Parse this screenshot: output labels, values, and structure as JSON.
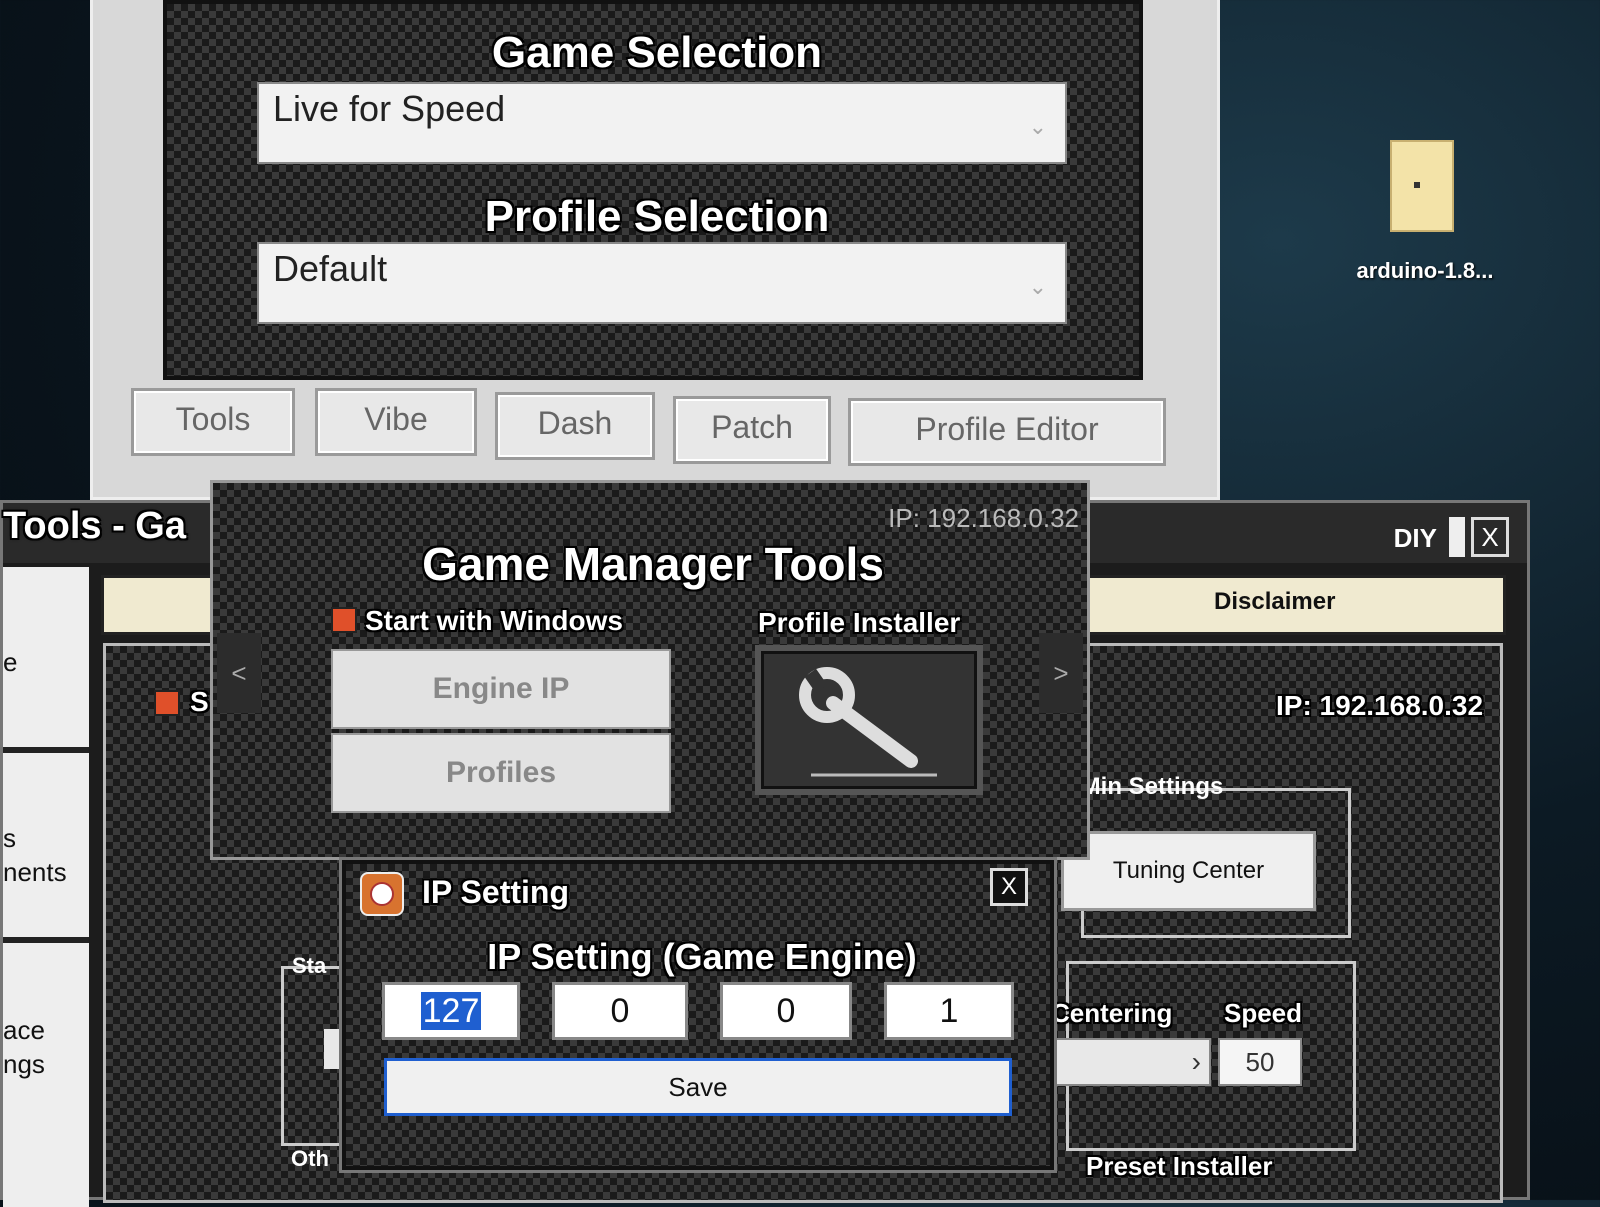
{
  "top_window": {
    "game_heading": "Game Selection",
    "game_value": "Live for Speed",
    "profile_heading": "Profile Selection",
    "profile_value": "Default",
    "tabs": [
      "Tools",
      "Vibe",
      "Dash",
      "Patch",
      "Profile Editor"
    ]
  },
  "back_window": {
    "title_fragment": "Tools - Ga",
    "diy_label": "DIY",
    "close_label": "X",
    "disclaimer_tab": "Disclaimer",
    "ip_label": "IP: 192.168.0.32",
    "settings_group_fragment": "/Min Settings",
    "tuning_center": "Tuning Center",
    "centering_label": "Centering",
    "speed_label": "Speed",
    "speed_value": "50",
    "preset_installer": "Preset Installer",
    "start_fragment": "Sta",
    "other_fragment": "Oth",
    "left_fragments": [
      "e",
      "s",
      "nents",
      "ace",
      "ngs"
    ],
    "s_fragment": "S",
    "arrow_right": "›",
    "arrow_left": "‹"
  },
  "game_manager_tools": {
    "ip_label": "IP: 192.168.0.32",
    "title": "Game Manager Tools",
    "start_with_windows": "Start with Windows",
    "engine_ip_button": "Engine IP",
    "profiles_button": "Profiles",
    "profile_installer_label": "Profile Installer",
    "prev_arrow": "<",
    "next_arrow": ">"
  },
  "ip_setting": {
    "title": "IP Setting",
    "heading": "IP Setting (Game Engine)",
    "octets": [
      "127",
      "0",
      "0",
      "1"
    ],
    "save_label": "Save",
    "close_label": "X"
  },
  "desktop": {
    "icon_label": "arduino-1.8..."
  },
  "colors": {
    "checkbox_accent": "#e0502a",
    "selection_blue": "#1f5fd0"
  }
}
